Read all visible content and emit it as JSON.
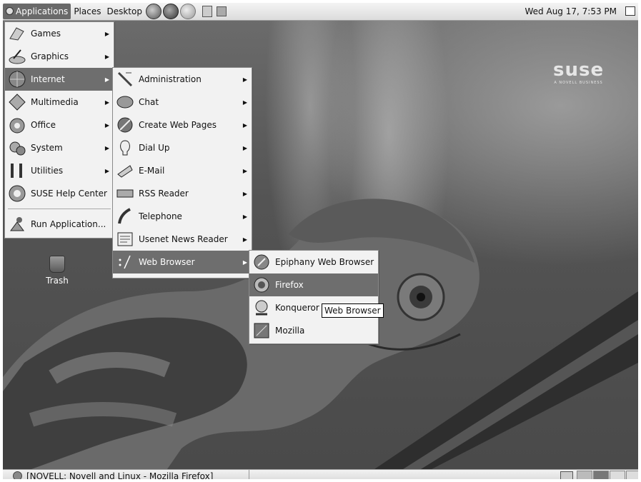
{
  "top_panel": {
    "applications_label": "Applications",
    "places_label": "Places",
    "desktop_label": "Desktop",
    "clock": "Wed Aug 17,  7:53 PM"
  },
  "applications_menu": {
    "items": [
      {
        "label": "Games",
        "icon": "games-icon",
        "submenu": true
      },
      {
        "label": "Graphics",
        "icon": "graphics-icon",
        "submenu": true
      },
      {
        "label": "Internet",
        "icon": "internet-icon",
        "submenu": true,
        "highlighted": true
      },
      {
        "label": "Multimedia",
        "icon": "multimedia-icon",
        "submenu": true
      },
      {
        "label": "Office",
        "icon": "office-icon",
        "submenu": true
      },
      {
        "label": "System",
        "icon": "system-icon",
        "submenu": true
      },
      {
        "label": "Utilities",
        "icon": "utilities-icon",
        "submenu": true
      },
      {
        "label": "SUSE Help Center",
        "icon": "help-icon",
        "submenu": false
      }
    ],
    "run_label": "Run Application..."
  },
  "internet_menu": {
    "items": [
      {
        "label": "Administration",
        "icon": "administration-icon",
        "submenu": true
      },
      {
        "label": "Chat",
        "icon": "chat-icon",
        "submenu": true
      },
      {
        "label": "Create Web Pages",
        "icon": "create-web-pages-icon",
        "submenu": true
      },
      {
        "label": "Dial Up",
        "icon": "dial-up-icon",
        "submenu": true
      },
      {
        "label": "E-Mail",
        "icon": "email-icon",
        "submenu": true
      },
      {
        "label": "RSS Reader",
        "icon": "rss-icon",
        "submenu": true
      },
      {
        "label": "Telephone",
        "icon": "telephone-icon",
        "submenu": true
      },
      {
        "label": "Usenet News Reader",
        "icon": "usenet-icon",
        "submenu": true
      },
      {
        "label": "Web Browser",
        "icon": "web-browser-icon",
        "submenu": true,
        "highlighted": true
      }
    ]
  },
  "web_browser_menu": {
    "items": [
      {
        "label": "Epiphany Web Browser",
        "icon": "epiphany-icon"
      },
      {
        "label": "Firefox",
        "icon": "firefox-icon",
        "highlighted": true
      },
      {
        "label": "Konqueror",
        "icon": "konqueror-icon"
      },
      {
        "label": "Mozilla",
        "icon": "mozilla-icon"
      }
    ]
  },
  "tooltip": "Web Browser",
  "desktop": {
    "trash_label": "Trash",
    "logo_text": "suse",
    "logo_subtext": "A NOVELL BUSINESS"
  },
  "taskbar": {
    "window_title": "[NOVELL: Novell and Linux - Mozilla Firefox]"
  },
  "colors": {
    "highlight": "#6e6e6e",
    "menu_bg": "#f2f2f2"
  }
}
